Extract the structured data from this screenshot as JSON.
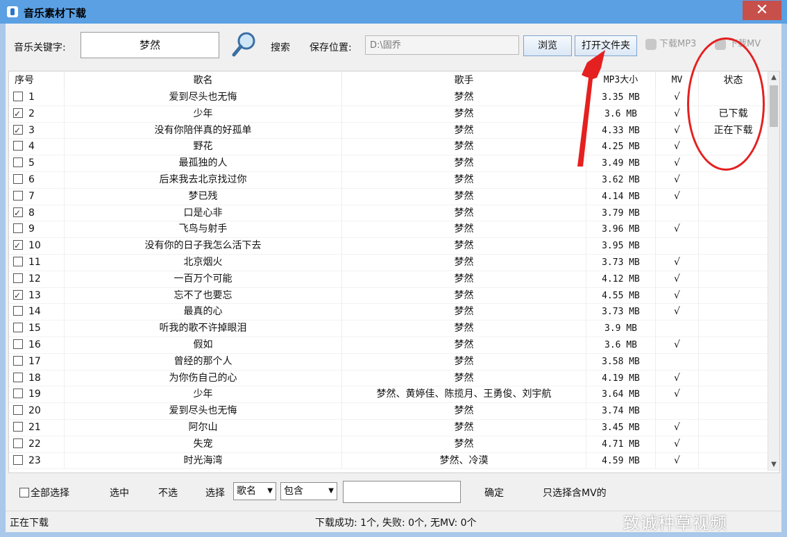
{
  "window": {
    "title": "音乐素材下载",
    "close_glyph": "✕"
  },
  "toolbar": {
    "keyword_label": "音乐关键字:",
    "keyword_value": "梦然",
    "search_label": "搜索",
    "save_label": "保存位置:",
    "save_path": "D:\\固乔",
    "browse_label": "浏览",
    "open_folder_label": "打开文件夹",
    "download_mp3_label": "下载MP3",
    "download_mv_label": "下载MV"
  },
  "table": {
    "columns": [
      "序号",
      "歌名",
      "歌手",
      "MP3大小",
      "MV",
      "状态"
    ],
    "rows": [
      {
        "n": "1",
        "checked": false,
        "song": "爱到尽头也无悔",
        "artist": "梦然",
        "size": "3.35 MB",
        "mv": "√",
        "status": ""
      },
      {
        "n": "2",
        "checked": true,
        "song": "少年",
        "artist": "梦然",
        "size": "3.6 MB",
        "mv": "√",
        "status": "已下载"
      },
      {
        "n": "3",
        "checked": true,
        "song": "没有你陪伴真的好孤单",
        "artist": "梦然",
        "size": "4.33 MB",
        "mv": "√",
        "status": "正在下载"
      },
      {
        "n": "4",
        "checked": false,
        "song": "野花",
        "artist": "梦然",
        "size": "4.25 MB",
        "mv": "√",
        "status": ""
      },
      {
        "n": "5",
        "checked": false,
        "song": "最孤独的人",
        "artist": "梦然",
        "size": "3.49 MB",
        "mv": "√",
        "status": ""
      },
      {
        "n": "6",
        "checked": false,
        "song": "后来我去北京找过你",
        "artist": "梦然",
        "size": "3.62 MB",
        "mv": "√",
        "status": ""
      },
      {
        "n": "7",
        "checked": false,
        "song": "梦已残",
        "artist": "梦然",
        "size": "4.14 MB",
        "mv": "√",
        "status": ""
      },
      {
        "n": "8",
        "checked": true,
        "song": "口是心非",
        "artist": "梦然",
        "size": "3.79 MB",
        "mv": "",
        "status": ""
      },
      {
        "n": "9",
        "checked": false,
        "song": "飞鸟与射手",
        "artist": "梦然",
        "size": "3.96 MB",
        "mv": "√",
        "status": ""
      },
      {
        "n": "10",
        "checked": true,
        "song": "没有你的日子我怎么活下去",
        "artist": "梦然",
        "size": "3.95 MB",
        "mv": "",
        "status": ""
      },
      {
        "n": "11",
        "checked": false,
        "song": "北京烟火",
        "artist": "梦然",
        "size": "3.73 MB",
        "mv": "√",
        "status": ""
      },
      {
        "n": "12",
        "checked": false,
        "song": "一百万个可能",
        "artist": "梦然",
        "size": "4.12 MB",
        "mv": "√",
        "status": ""
      },
      {
        "n": "13",
        "checked": true,
        "song": "忘不了也要忘",
        "artist": "梦然",
        "size": "4.55 MB",
        "mv": "√",
        "status": ""
      },
      {
        "n": "14",
        "checked": false,
        "song": "最真的心",
        "artist": "梦然",
        "size": "3.73 MB",
        "mv": "√",
        "status": ""
      },
      {
        "n": "15",
        "checked": false,
        "song": "听我的歌不许掉眼泪",
        "artist": "梦然",
        "size": "3.9 MB",
        "mv": "",
        "status": ""
      },
      {
        "n": "16",
        "checked": false,
        "song": "假如",
        "artist": "梦然",
        "size": "3.6 MB",
        "mv": "√",
        "status": ""
      },
      {
        "n": "17",
        "checked": false,
        "song": "曾经的那个人",
        "artist": "梦然",
        "size": "3.58 MB",
        "mv": "",
        "status": ""
      },
      {
        "n": "18",
        "checked": false,
        "song": "为你伤自己的心",
        "artist": "梦然",
        "size": "4.19 MB",
        "mv": "√",
        "status": ""
      },
      {
        "n": "19",
        "checked": false,
        "song": "少年",
        "artist": "梦然、黄婷佳、陈揽月、王勇俊、刘宇航",
        "size": "3.64 MB",
        "mv": "√",
        "status": ""
      },
      {
        "n": "20",
        "checked": false,
        "song": "爱到尽头也无悔",
        "artist": "梦然",
        "size": "3.74 MB",
        "mv": "",
        "status": ""
      },
      {
        "n": "21",
        "checked": false,
        "song": "阿尔山",
        "artist": "梦然",
        "size": "3.45 MB",
        "mv": "√",
        "status": ""
      },
      {
        "n": "22",
        "checked": false,
        "song": "失宠",
        "artist": "梦然",
        "size": "4.71 MB",
        "mv": "√",
        "status": ""
      },
      {
        "n": "23",
        "checked": false,
        "song": "时光海湾",
        "artist": "梦然、冷漠",
        "size": "4.59 MB",
        "mv": "√",
        "status": ""
      }
    ]
  },
  "bottom": {
    "select_all_label": "全部选择",
    "select_label": "选中",
    "unselect_label": "不选",
    "choose_label": "选择",
    "field_option": "歌名",
    "match_option": "包含",
    "confirm_label": "确定",
    "only_mv_label": "只选择含MV的"
  },
  "status": {
    "left": "正在下载",
    "summary": "下载成功: 1个, 失败: 0个, 无MV: 0个"
  },
  "watermark": "致诚种草视频",
  "colors": {
    "title_bar": "#5aa0e3",
    "annotation": "#e52020",
    "close": "#c7504b"
  }
}
